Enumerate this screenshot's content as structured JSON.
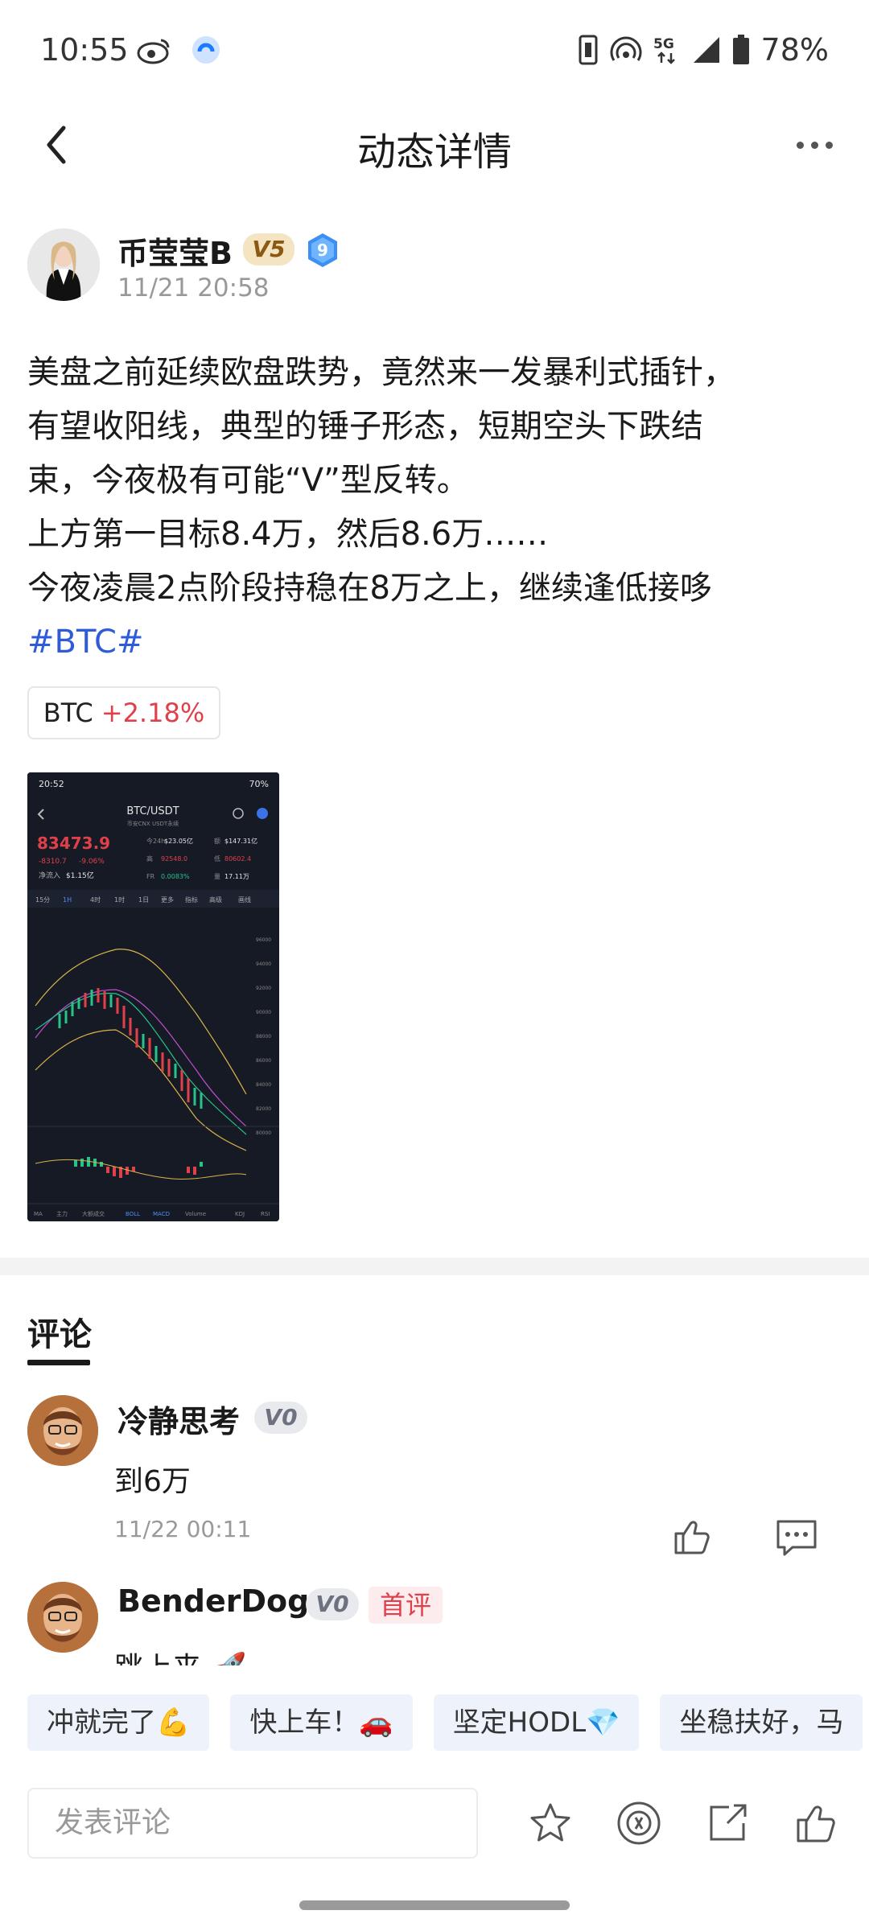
{
  "status_bar": {
    "time": "10:55",
    "battery": "78%",
    "network": "5G",
    "icons": [
      "weibo-icon",
      "app-notification-icon",
      "vibrate-icon",
      "hotspot-icon",
      "5g-icon",
      "signal-icon",
      "battery-icon"
    ]
  },
  "header": {
    "title": "动态详情",
    "back_icon": "chevron-left-icon",
    "more_icon": "more-dots-icon"
  },
  "post": {
    "author": {
      "name": "币莹莹B",
      "vip_badge": "V5",
      "level_badge": "9",
      "time": "11/21 20:58"
    },
    "lines": [
      "美盘之前延续欧盘跌势，竟然来一发暴利式插针，",
      "有望收阳线，典型的锤子形态，短期空头下跌结",
      "束，今夜极有可能“V”型反转。",
      "上方第一目标8.4万，然后8.6万……",
      "今夜凌晨2点阶段持稳在8万之上，继续逢低接哆"
    ],
    "hashtag": "#BTC#",
    "coin_tag": {
      "symbol": "BTC",
      "change": "+2.18%"
    },
    "image": {
      "time": "20:52",
      "battery": "70%",
      "pair": "BTC/USDT",
      "subtitle": "币安CNX USDT永续",
      "price": "83473.9",
      "change": "-8310.7",
      "change_pct": "-9.06%",
      "net_inflow_label": "净流入",
      "net_inflow": "$1.15亿",
      "stats": [
        {
          "label": "今24h",
          "value": "$23.05亿"
        },
        {
          "label": "额",
          "value": "$147.31亿"
        },
        {
          "label": "高",
          "value": "92548.0"
        },
        {
          "label": "低",
          "value": "80602.4"
        },
        {
          "label": "FR",
          "value": "0.0083%"
        },
        {
          "label": "量",
          "value": "17.11万"
        }
      ],
      "tabs": [
        "15分",
        "1H",
        "4时",
        "1时",
        "1日",
        "更多",
        "指标",
        "高级",
        "画线"
      ],
      "axis_labels": [
        "96000",
        "94000",
        "92000",
        "90000",
        "88000",
        "86000",
        "84000",
        "82000",
        "80000"
      ],
      "bottom_tabs": [
        "MA",
        "主力",
        "大额成交",
        "BOLL",
        "MACD",
        "Volume",
        "KDJ",
        "RSI"
      ]
    }
  },
  "comments": {
    "title": "评论",
    "items": [
      {
        "name": "冷静思考",
        "badge": "V0",
        "text": "到6万",
        "time": "11/22 00:11"
      },
      {
        "name": "BenderDog",
        "badge": "V0",
        "first_badge": "首评",
        "text": "跳上来 🚀"
      }
    ]
  },
  "quick_replies": [
    "冲就完了💪",
    "快上车！🚗",
    "坚定HODL💎",
    "坐稳扶好，马"
  ],
  "input": {
    "placeholder": "发表评论",
    "actions": [
      "star-icon",
      "coin-tip-icon",
      "share-icon",
      "like-icon"
    ]
  },
  "colors": {
    "accent_blue": "#2f5bd8",
    "up_red": "#e0404a",
    "badge_gold": "#f4e4c1",
    "chip_bg": "#eef3fb"
  }
}
